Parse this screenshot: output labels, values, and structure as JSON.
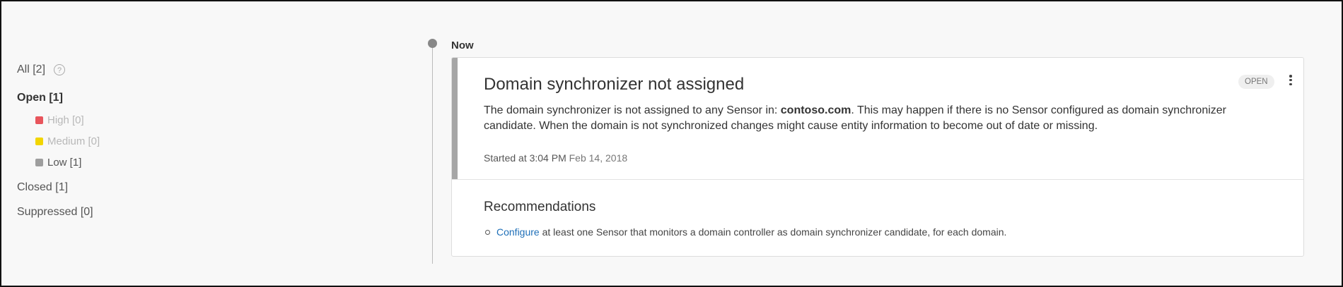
{
  "sidebar": {
    "all": "All [2]",
    "open": "Open [1]",
    "severity": [
      {
        "label": "High [0]",
        "color": "#e8555c"
      },
      {
        "label": "Medium [0]",
        "color": "#f2d500"
      },
      {
        "label": "Low [1]",
        "color": "#9e9e9e"
      }
    ],
    "closed": "Closed [1]",
    "suppressed": "Suppressed [0]"
  },
  "timeline": {
    "label": "Now"
  },
  "alert": {
    "title": "Domain synchronizer not assigned",
    "status": "OPEN",
    "desc_before": "The domain synchronizer is not assigned to any Sensor in: ",
    "domain": "contoso.com",
    "desc_after": ". This may happen if there is no Sensor configured as domain synchronizer candidate. When the domain is not synchronized changes might cause entity information to become out of date or missing.",
    "started_prefix": "Started at 3:04 PM",
    "started_date": "Feb 14, 2018",
    "recommendations_title": "Recommendations",
    "recommendation_link": "Configure",
    "recommendation_text": " at least one Sensor that monitors a domain controller as domain synchronizer candidate, for each domain."
  }
}
